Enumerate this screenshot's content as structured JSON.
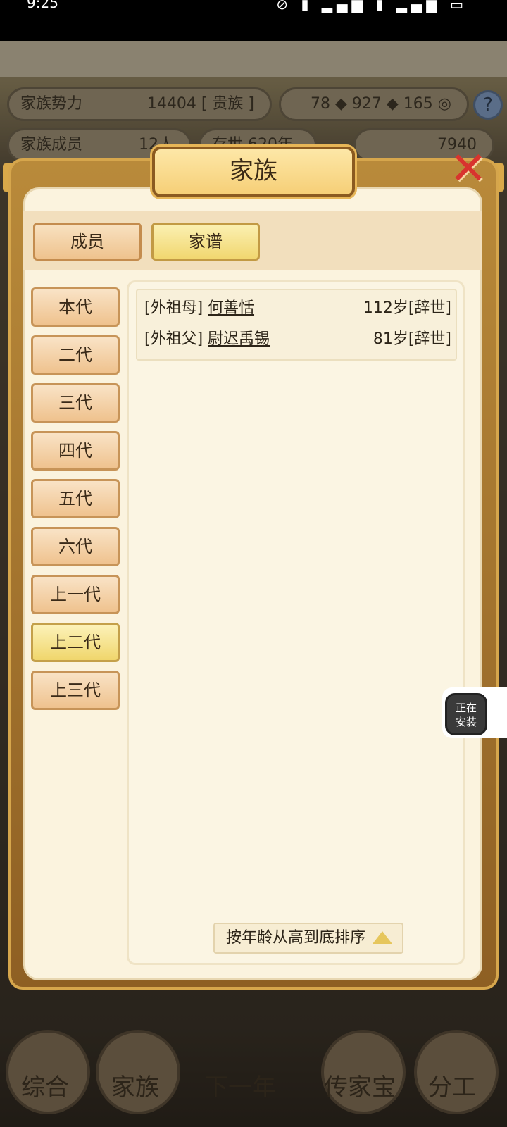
{
  "status_bar": {
    "time": "9:25",
    "icons": "⊘ ▮ ▂▄▆ ▮ ▂▄▆ ▭"
  },
  "background": {
    "stats": [
      {
        "label": "家族势力",
        "value": "14404 [ 贵族 ]"
      },
      {
        "label": "",
        "value": "78 ◆ 927 ◆ 165 ◎"
      },
      {
        "label": "家族成员",
        "value": "12人"
      },
      {
        "label": "存世 620年",
        "value": ""
      },
      {
        "label": "",
        "value": "7940"
      }
    ],
    "help_label": "?",
    "bottom_nav": [
      "综合",
      "家族",
      "下一年",
      "传家宝",
      "分工"
    ]
  },
  "dialog": {
    "title": "家族",
    "close_label": "✕",
    "tabs": [
      {
        "label": "成员",
        "active": false
      },
      {
        "label": "家谱",
        "active": true
      }
    ],
    "generations": [
      {
        "label": "本代",
        "active": false
      },
      {
        "label": "二代",
        "active": false
      },
      {
        "label": "三代",
        "active": false
      },
      {
        "label": "四代",
        "active": false
      },
      {
        "label": "五代",
        "active": false
      },
      {
        "label": "六代",
        "active": false
      },
      {
        "label": "上一代",
        "active": false
      },
      {
        "label": "上二代",
        "active": true
      },
      {
        "label": "上三代",
        "active": false
      }
    ],
    "records": [
      {
        "role": "[外祖母]",
        "name": "何善恬",
        "age": "112岁[辞世]"
      },
      {
        "role": "[外祖父]",
        "name": "尉迟禹锡",
        "age": "81岁[辞世]"
      }
    ],
    "sort_label": "按年龄从高到底排序"
  },
  "installing": {
    "label_line1": "正在",
    "label_line2": "安装"
  }
}
